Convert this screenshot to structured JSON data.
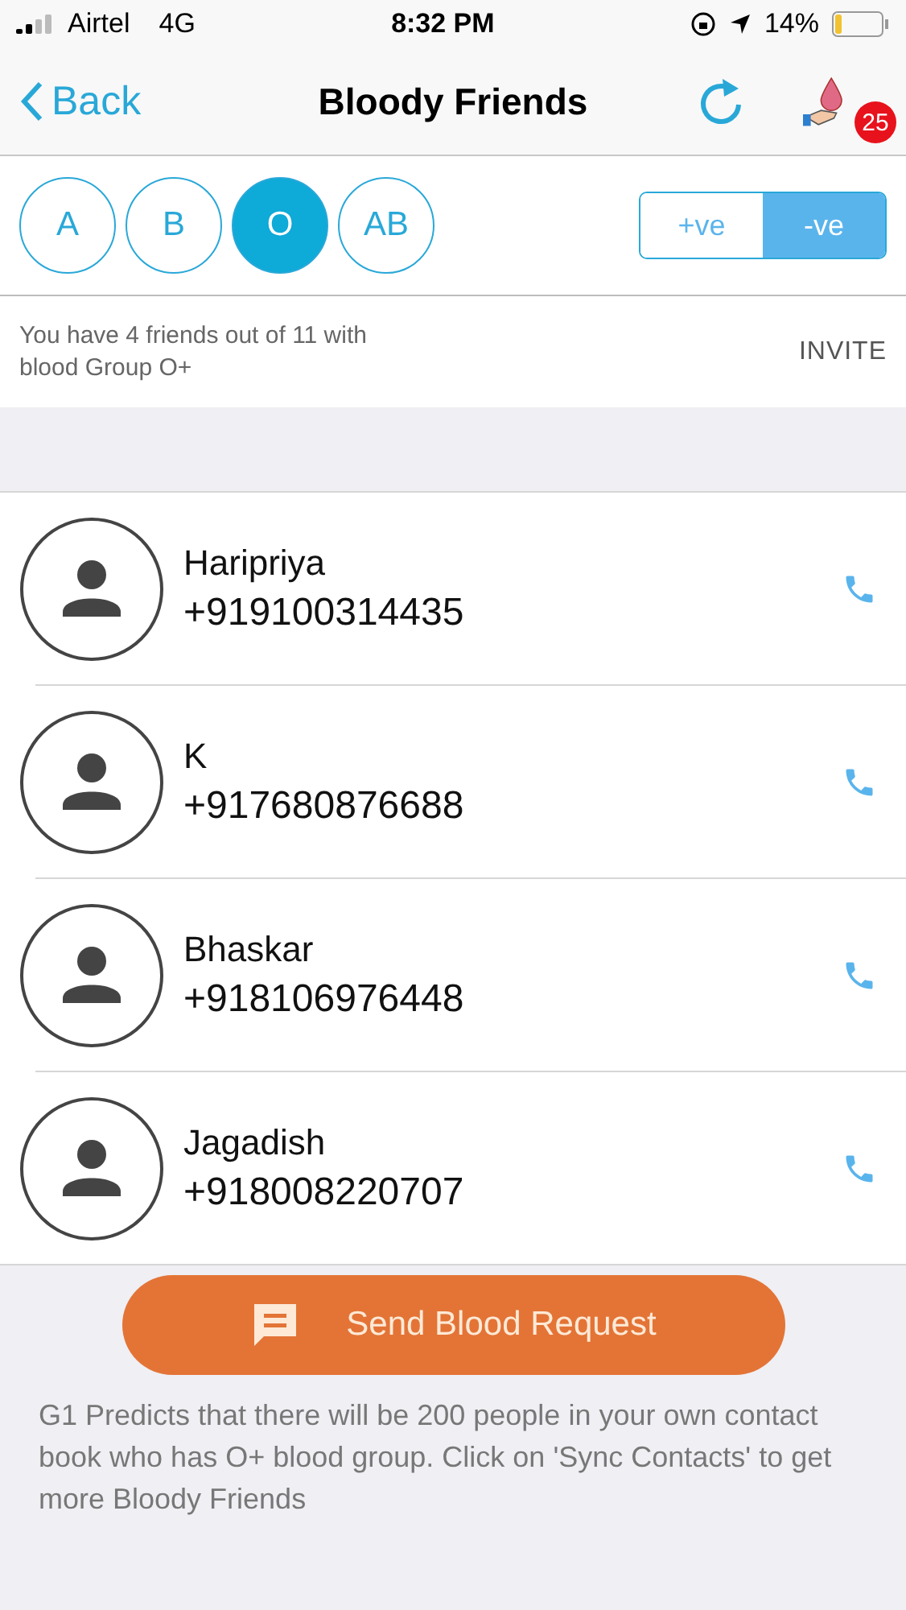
{
  "status_bar": {
    "carrier": "Airtel",
    "network": "4G",
    "time": "8:32 PM",
    "battery": "14%"
  },
  "nav": {
    "back": "Back",
    "title": "Bloody Friends",
    "badge": "25"
  },
  "groups": [
    {
      "label": "A",
      "selected": false
    },
    {
      "label": "B",
      "selected": false
    },
    {
      "label": "O",
      "selected": true
    },
    {
      "label": "AB",
      "selected": false
    }
  ],
  "rh": [
    {
      "label": "+ve",
      "selected": false
    },
    {
      "label": "-ve",
      "selected": true
    }
  ],
  "summary": {
    "text": "You have 4 friends out of 11 with blood Group O+",
    "action": "INVITE"
  },
  "friends": [
    {
      "name": "Haripriya",
      "phone": "+919100314435"
    },
    {
      "name": "K",
      "phone": "+917680876688"
    },
    {
      "name": "Bhaskar",
      "phone": "+918106976448"
    },
    {
      "name": "Jagadish",
      "phone": "+918008220707"
    }
  ],
  "request_button": "Send Blood Request",
  "note": "G1 Predicts that there will be 200 people in your own contact book who has O+ blood group. Click on 'Sync Contacts' to get more Bloody Friends"
}
